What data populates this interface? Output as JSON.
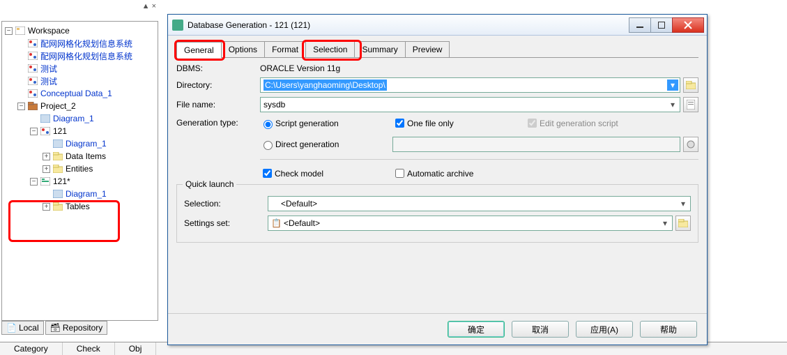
{
  "tree": {
    "root": "Workspace",
    "n1": "配网网格化规划信息系统",
    "n2": "配网网格化规划信息系统",
    "n3": "测试",
    "n4": "测试",
    "n5": "Conceptual Data_1",
    "proj": "Project_2",
    "diag1": "Diagram_1",
    "m121": "121",
    "diag2": "Diagram_1",
    "dataitems": "Data Items",
    "entities": "Entities",
    "m121s": "121*",
    "diag3": "Diagram_1",
    "tables": "Tables"
  },
  "tabs_bottom": {
    "local": "Local",
    "repo": "Repository"
  },
  "bottom": {
    "cat": "Category",
    "check": "Check",
    "obj": "Obj"
  },
  "dialog": {
    "title": "Database Generation - 121 (121)",
    "tabs": {
      "general": "General",
      "options": "Options",
      "format": "Format",
      "selection": "Selection",
      "summary": "Summary",
      "preview": "Preview"
    },
    "dbms_lbl": "DBMS:",
    "dbms_val": "ORACLE Version 11g",
    "dir_lbl": "Directory:",
    "dir_val": "C:\\Users\\yanghaoming\\Desktop\\",
    "file_lbl": "File name:",
    "file_val": "sysdb",
    "gen_lbl": "Generation type:",
    "script_gen": "Script generation",
    "direct_gen": "Direct generation",
    "one_file": "One file only",
    "edit_script": "Edit generation script",
    "check_model": "Check model",
    "auto_archive": "Automatic archive",
    "quick_launch": "Quick launch",
    "selection_lbl": "Selection:",
    "settings_lbl": "Settings set:",
    "default": "<Default>",
    "ok": "确定",
    "cancel": "取消",
    "apply": "应用(A)",
    "help": "帮助"
  }
}
